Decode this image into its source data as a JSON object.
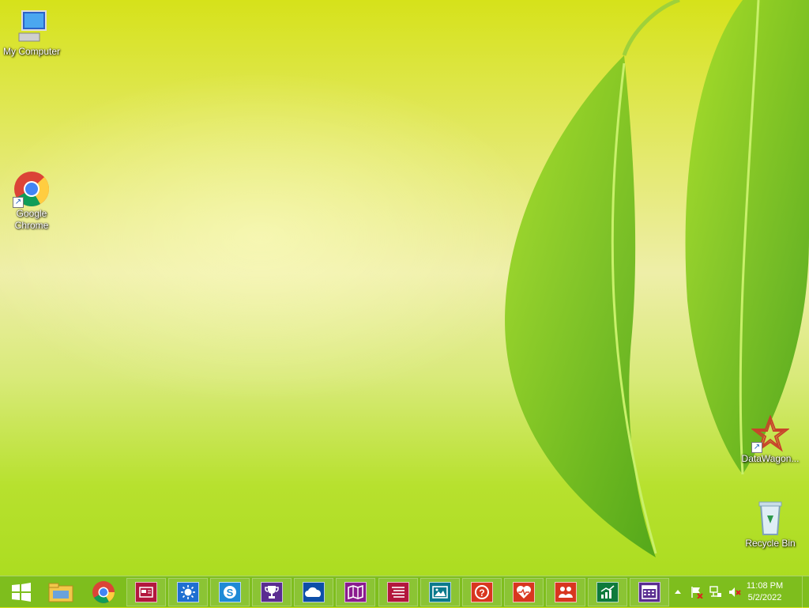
{
  "desktop": {
    "icons": [
      {
        "label": "My Computer",
        "icon": "computer-icon"
      },
      {
        "label": "Google Chrome",
        "icon": "chrome-icon"
      },
      {
        "label": "DataWagon...",
        "icon": "datawagon-icon"
      },
      {
        "label": "Recycle Bin",
        "icon": "recycle-bin-icon"
      }
    ]
  },
  "taskbar": {
    "pinned": [
      {
        "icon": "start-icon"
      },
      {
        "icon": "file-explorer-icon"
      },
      {
        "icon": "chrome-icon"
      },
      {
        "icon": "news-icon",
        "color": "#b3173d"
      },
      {
        "icon": "weather-icon",
        "color": "#1f6fd1"
      },
      {
        "icon": "skype-icon",
        "color": "#1e8ad6"
      },
      {
        "icon": "trophy-icon",
        "color": "#5a2d91"
      },
      {
        "icon": "onedrive-icon",
        "color": "#0d4fa8"
      },
      {
        "icon": "maps-icon",
        "color": "#8a1b8e"
      },
      {
        "icon": "reading-list-icon",
        "color": "#b3173d"
      },
      {
        "icon": "photos-icon",
        "color": "#0b7a8c"
      },
      {
        "icon": "help-icon",
        "color": "#d8361f"
      },
      {
        "icon": "health-icon",
        "color": "#d8361f"
      },
      {
        "icon": "people-icon",
        "color": "#d8361f"
      },
      {
        "icon": "finance-icon",
        "color": "#0e7a3b"
      },
      {
        "icon": "calendar-icon",
        "color": "#5a2d91"
      }
    ],
    "tray": {
      "icons": [
        "show-hidden-icons-icon",
        "action-center-flag-icon",
        "network-icon",
        "volume-muted-icon"
      ],
      "time": "11:08 PM",
      "date": "5/2/2022"
    }
  }
}
